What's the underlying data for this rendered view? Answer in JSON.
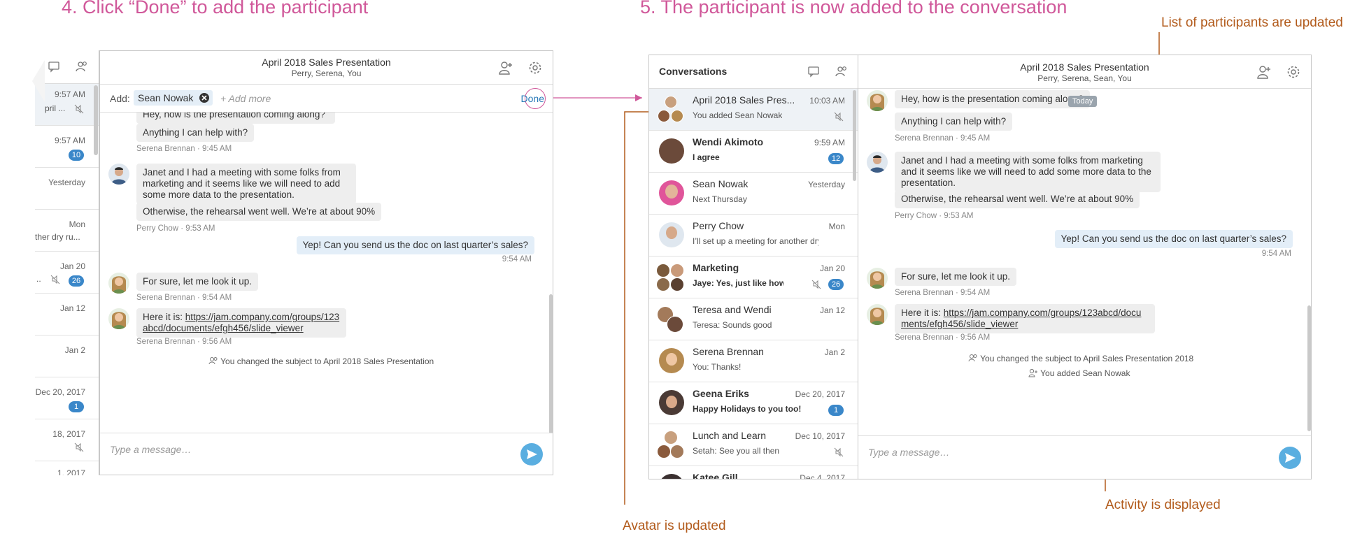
{
  "step4_title": "4. Click “Done” to add the participant",
  "step5_title": "5. The participant is now added to the conversation",
  "annotations": {
    "participants_updated": "List of participants are updated",
    "avatar_updated": "Avatar is updated",
    "activity_displayed": "Activity is displayed"
  },
  "colors": {
    "step_title": "#d0589a",
    "annotation": "#b25b1c",
    "badge": "#3a87c9",
    "send": "#5aaee0"
  },
  "left_panel": {
    "header": {
      "title": "April 2018 Sales Presentation",
      "subtitle": "Perry, Serena, You"
    },
    "add_bar": {
      "label": "Add:",
      "chip": "Sean Nowak",
      "placeholder": "+ Add more",
      "done": "Done"
    },
    "sidebar": [
      {
        "time": "9:57 AM",
        "preview": "pril ..."
      },
      {
        "time": "9:57 AM",
        "badge": "10"
      },
      {
        "time": "Yesterday"
      },
      {
        "time": "Mon",
        "preview": "ther dry ru..."
      },
      {
        "time": "Jan 20",
        "preview": "..",
        "badge": "26"
      },
      {
        "time": "Jan 12"
      },
      {
        "time": "Jan 2"
      },
      {
        "time": "Dec 20, 2017",
        "badge": "1"
      },
      {
        "time": "18, 2017"
      },
      {
        "time": "1, 2017"
      }
    ],
    "messages": {
      "m1_cut": "Hey, how is the presentation coming along?",
      "m2": "Anything I can help with?",
      "m2_meta": "Serena Brennan · 9:45 AM",
      "m3": "Janet and I had a meeting with some folks from marketing and it seems like we will need to add some more data to the presentation.",
      "m4": "Otherwise, the rehearsal went well. We’re at about 90%",
      "m4_meta": "Perry Chow · 9:53 AM",
      "m5": "Yep! Can you send us the doc on last quarter’s sales?",
      "m5_meta": "9:54 AM",
      "m6": "For sure, let me look it up.",
      "m6_meta": "Serena Brennan · 9:54 AM",
      "m7_prefix": "Here it is: ",
      "m7_link": "https://jam.company.com/groups/123abcd/documents/efgh456/slide_viewer",
      "m7_meta": "Serena Brennan · 9:56 AM",
      "activity": "You changed the subject to April 2018 Sales Presentation"
    },
    "composer_placeholder": "Type a message…"
  },
  "right_panel": {
    "list_header": "Conversations",
    "conversations": [
      {
        "name": "April 2018 Sales Pres...",
        "time": "10:03 AM",
        "preview": "You added Sean Nowak",
        "muted": true
      },
      {
        "name": "Wendi Akimoto",
        "time": "9:59 AM",
        "preview": "I agree",
        "badge": "12"
      },
      {
        "name": "Sean Nowak",
        "time": "Yesterday",
        "preview": "Next Thursday"
      },
      {
        "name": "Perry Chow",
        "time": "Mon",
        "preview": "I’ll set up a meeting for another dry ru..."
      },
      {
        "name": "Marketing",
        "time": "Jan 20",
        "preview": "Jaye: Yes, just like how it ...",
        "badge": "26",
        "muted": true
      },
      {
        "name": "Teresa and Wendi",
        "time": "Jan 12",
        "preview": "Teresa: Sounds good"
      },
      {
        "name": "Serena Brennan",
        "time": "Jan 2",
        "preview": "You: Thanks!"
      },
      {
        "name": "Geena Eriks",
        "time": "Dec 20, 2017",
        "preview": "Happy Holidays to you too!",
        "badge": "1"
      },
      {
        "name": "Lunch and Learn",
        "time": "Dec 10, 2017",
        "preview": "Setah: See you all then",
        "muted": true
      },
      {
        "name": "Katee Gill",
        "time": "Dec 4, 2017",
        "preview": ""
      }
    ],
    "header": {
      "title": "April 2018 Sales Presentation",
      "subtitle": "Perry, Serena, Sean, You"
    },
    "messages": {
      "m1": "Hey, how is the presentation coming along?",
      "today": "Today",
      "m2": "Anything I can help with?",
      "m2_meta": "Serena Brennan · 9:45 AM",
      "m3": "Janet and I had a meeting with some folks from marketing and it seems like we will need to add some more data to the presentation.",
      "m4": "Otherwise, the rehearsal went well. We’re at about 90%",
      "m4_meta": "Perry Chow · 9:53 AM",
      "m5": "Yep! Can you send us the doc on last quarter’s sales?",
      "m5_meta": "9:54 AM",
      "m6": "For sure, let me look it up.",
      "m6_meta": "Serena Brennan · 9:54 AM",
      "m7_prefix": "Here it is: ",
      "m7_link": "https://jam.company.com/groups/123abcd/documents/efgh456/slide_viewer",
      "m7_meta": "Serena Brennan · 9:56 AM",
      "activity1": "You changed the subject to April Sales Presentation 2018",
      "activity2": "You added Sean Nowak"
    },
    "composer_placeholder": "Type a message…"
  }
}
